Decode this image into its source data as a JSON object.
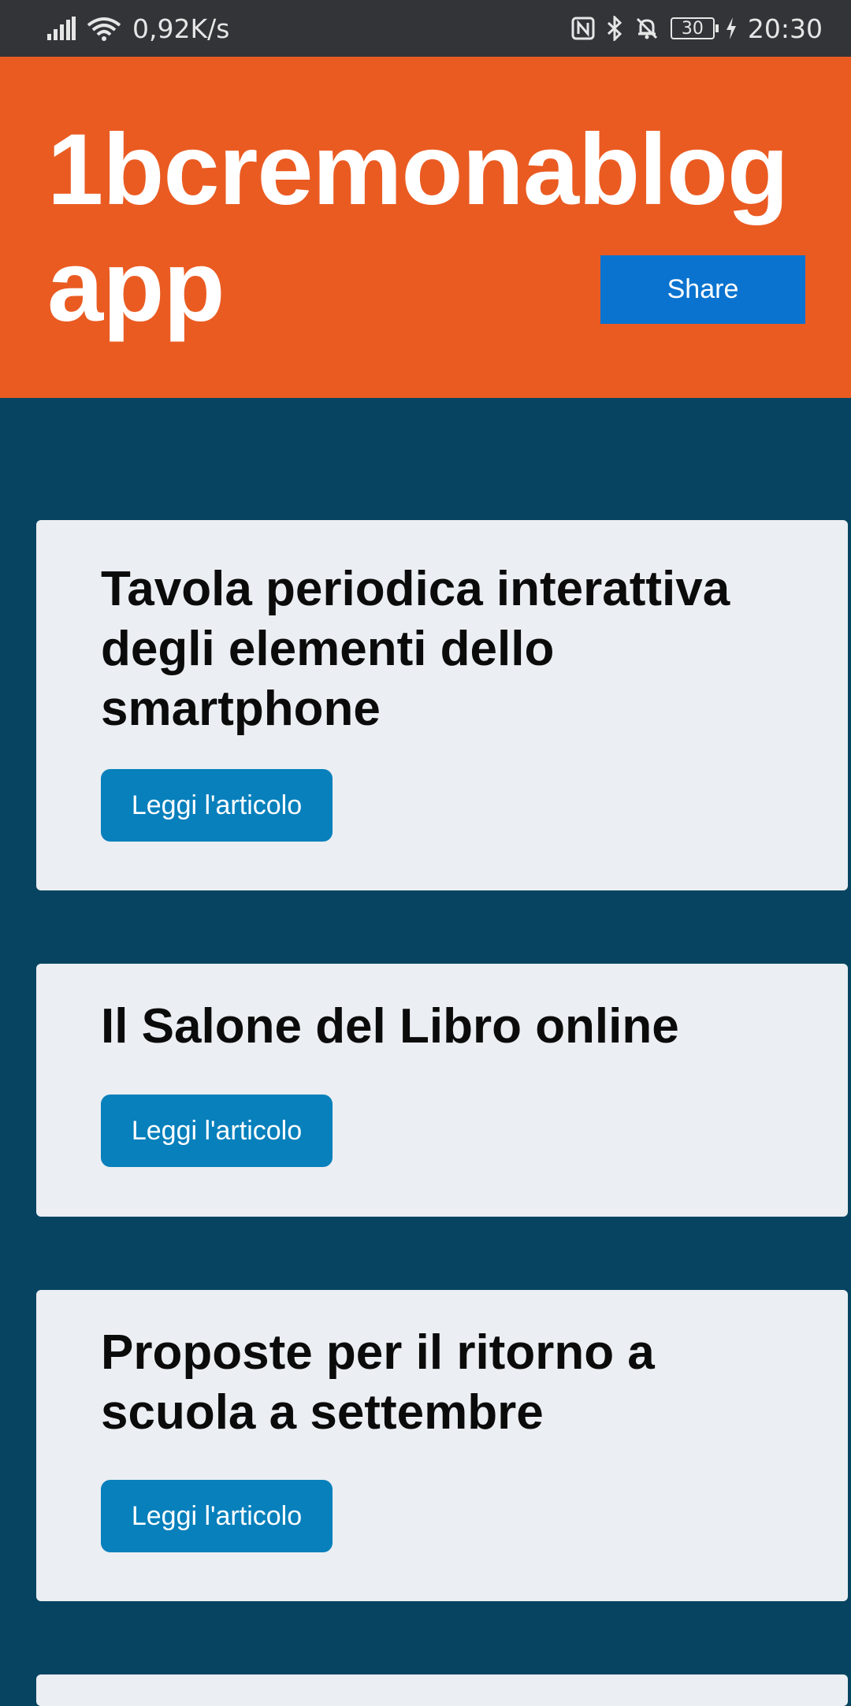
{
  "status_bar": {
    "network_speed": "0,92K/s",
    "battery_level": "30",
    "time": "20:30",
    "icons": [
      "signal-icon",
      "wifi-icon",
      "nfc-icon",
      "bluetooth-icon",
      "notifications-off-icon",
      "battery-icon",
      "charging-icon"
    ]
  },
  "header": {
    "title": "1bcremonablog app",
    "share_label": "Share",
    "background_color": "#ea5b22",
    "share_color": "#0a73cf"
  },
  "articles": [
    {
      "title": "Tavola periodica interattiva degli elementi dello smartphone",
      "button_label": "Leggi l'articolo"
    },
    {
      "title": "Il Salone del Libro online",
      "button_label": "Leggi l'articolo"
    },
    {
      "title": "Proposte per il ritorno a scuola a settembre",
      "button_label": "Leggi l'articolo"
    }
  ],
  "colors": {
    "page_background": "#064461",
    "card_background": "#ebeef2",
    "button_background": "#0780bc"
  }
}
